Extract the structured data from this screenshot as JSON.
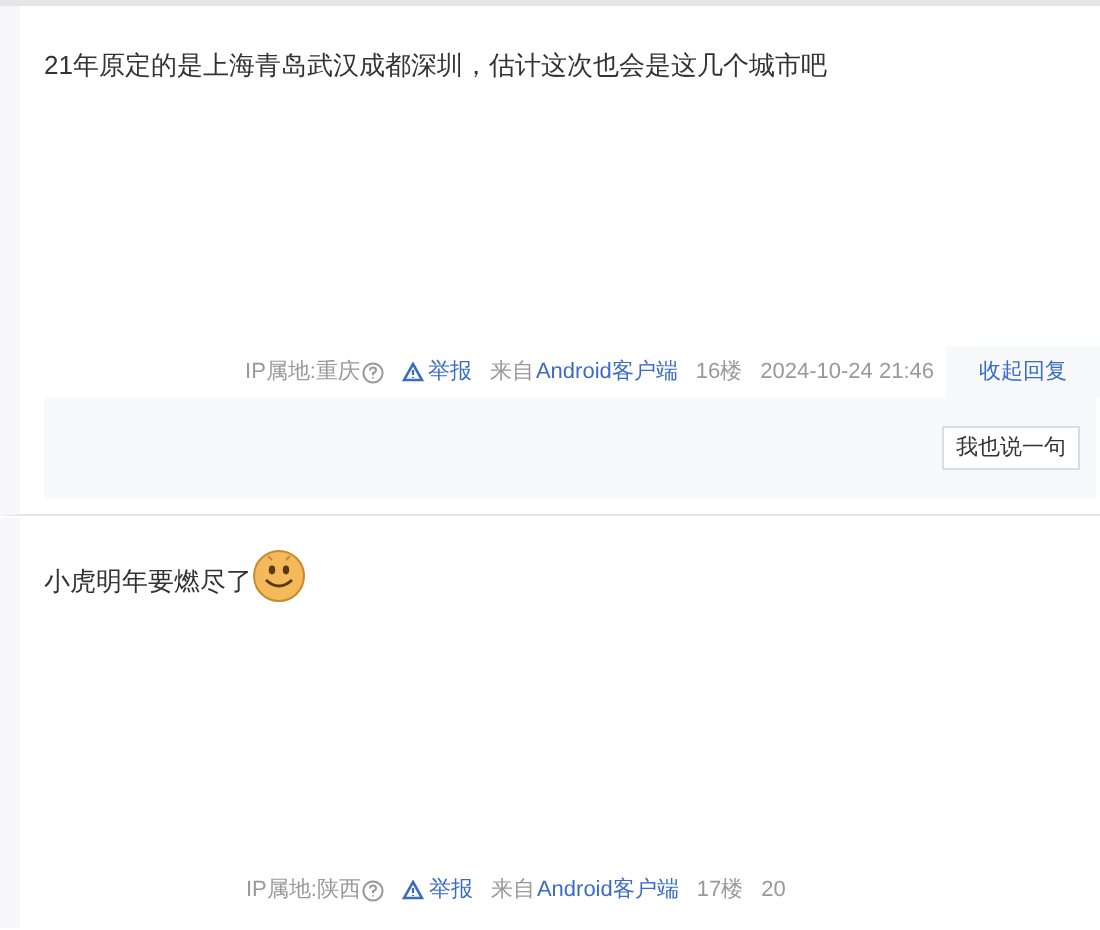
{
  "posts": [
    {
      "content": "21年原定的是上海青岛武汉成都深圳，估计这次也会是这几个城市吧",
      "emoticon": false,
      "meta": {
        "ip": "IP属地:重庆",
        "report": "举报",
        "source_prefix": "来自",
        "source_client": "Android客户端",
        "floor": "16楼",
        "time": "2024-10-24 21:46"
      },
      "reply_toggle": "收起回复",
      "reply_button": "我也说一句"
    },
    {
      "content": "小虎明年要燃尽了",
      "emoticon": true,
      "meta": {
        "ip": "IP属地:陕西",
        "report": "举报",
        "source_prefix": "来自",
        "source_client": "Android客户端",
        "floor": "17楼",
        "time": "20"
      }
    }
  ]
}
